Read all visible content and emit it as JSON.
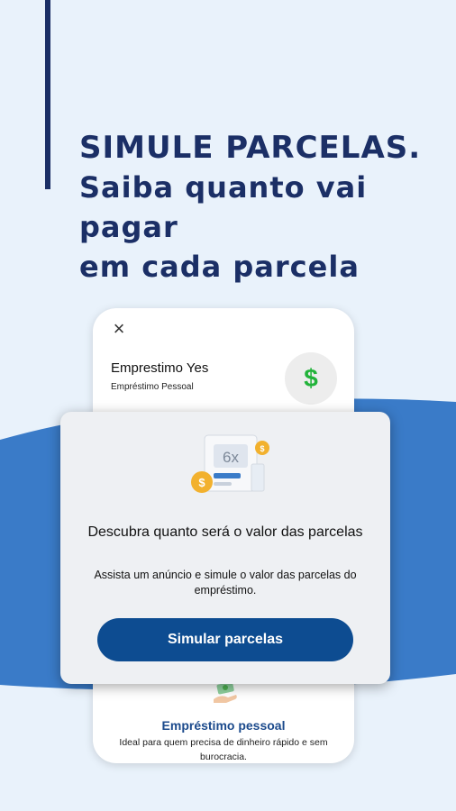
{
  "headline": {
    "line1": "SIMULE PARCELAS.",
    "line2": "Saiba quanto vai pagar",
    "line3": "em cada parcela"
  },
  "card": {
    "title": "Emprestimo Yes",
    "subtitle": "Empréstimo Pessoal",
    "badge_symbol": "$",
    "bottom_title": "Empréstimo pessoal",
    "bottom_description": "Ideal para quem precisa de dinheiro rápido e sem burocracia."
  },
  "modal": {
    "illustration_label": "6x",
    "illustration_symbol": "$",
    "title": "Descubra quanto será o valor das parcelas",
    "text": "Assista um anúncio e simule o valor das parcelas do empréstimo.",
    "button_label": "Simular parcelas"
  },
  "icons": {
    "close": "close-icon",
    "dollar": "dollar-icon"
  },
  "colors": {
    "navy": "#1b2f66",
    "band_blue": "#3a7bc8",
    "button_blue": "#0d4c91",
    "dollar_green": "#22b33a",
    "coin_gold": "#f2b12e"
  }
}
